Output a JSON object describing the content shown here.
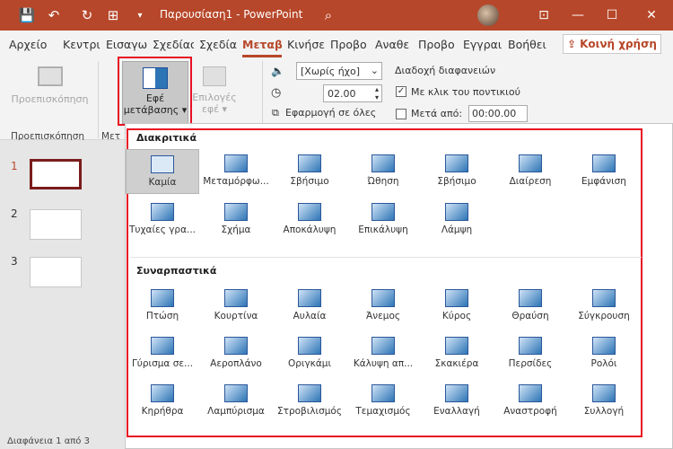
{
  "window": {
    "title": "Παρουσίαση1 - PowerPoint",
    "accent": "#b7472a"
  },
  "quick_access": {
    "save": "💾",
    "undo": "↶",
    "redo": "↻",
    "present": "⊞"
  },
  "tabs": [
    "Αρχείο",
    "Κεντρι",
    "Εισαγω",
    "Σχεδίασ",
    "Σχεδία",
    "Μεταβ",
    "Κινήσει",
    "Προβο",
    "Αναθε",
    "Προβο",
    "Εγγραι",
    "Βοήθει"
  ],
  "share_label": "Κοινή χρήση",
  "ribbon": {
    "preview": "Προεπισκόπηση",
    "preview_group": "Προεπισκόπηση",
    "effects_line1": "Εφέ",
    "effects_line2": "μετάβασης",
    "options_line1": "Επιλογές",
    "options_line2": "εφέ",
    "sound": "[Χωρίς ήχο]",
    "duration": "02.00",
    "apply_all": "Εφαρμογή σε όλες",
    "advance": "Διαδοχή διαφανειών",
    "on_click": "Με κλικ του ποντικιού",
    "after": "Μετά από:",
    "after_time": "00:00.00",
    "partial": "Μετ"
  },
  "sections": {
    "subtle": "Διακριτικά",
    "exciting": "Συναρπαστικά"
  },
  "subtle": [
    "Καμία",
    "Μεταμόρφω...",
    "Σβήσιμο",
    "Ώθηση",
    "Σβήσιμο",
    "Διαίρεση",
    "Εμφάνιση",
    "Τυχαίες γρα...",
    "Σχήμα",
    "Αποκάλυψη",
    "Επικάλυψη",
    "Λάμψη"
  ],
  "exciting": [
    "Πτώση",
    "Κουρτίνα",
    "Αυλαία",
    "Άνεμος",
    "Κύρος",
    "Θραύση",
    "Σύγκρουση",
    "Γύρισμα σε...",
    "Αεροπλάνο",
    "Οριγκάμι",
    "Κάλυψη απ...",
    "Σκακιέρα",
    "Περσίδες",
    "Ρολόι",
    "Κηρήθρα",
    "Λαμπύρισμα",
    "Στροβιλισμός",
    "Τεμαχισμός",
    "Εναλλαγή",
    "Αναστροφή",
    "Συλλογή"
  ],
  "slides": [
    "1",
    "2",
    "3"
  ],
  "status": "Διαφάνεια 1 από 3"
}
